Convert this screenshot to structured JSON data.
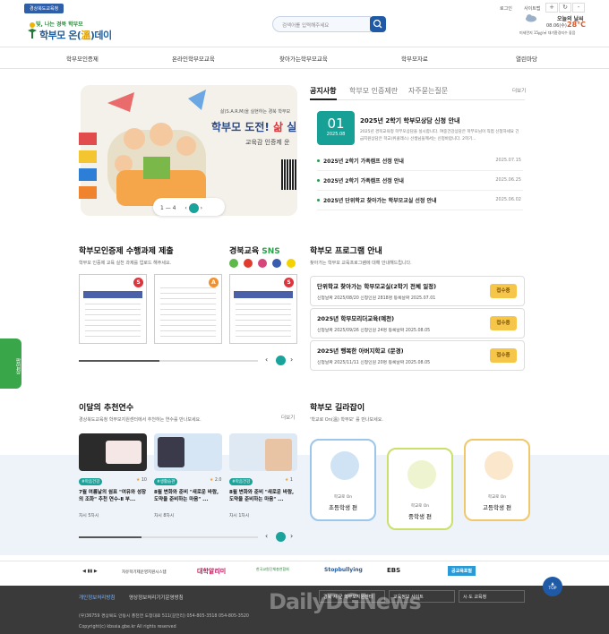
{
  "topbar": {
    "edu_badge": "경상북도교육청",
    "login": "로그인",
    "sitemap": "사이트맵",
    "zoom_in": "+",
    "zoom_out": "-"
  },
  "logo": {
    "line1": "빛, 나는 경북 학부모",
    "line2_a": "학부모 온(",
    "line2_b": "溫",
    "line2_c": ")데이"
  },
  "search": {
    "placeholder": "검색어를 입력해주세요"
  },
  "weather": {
    "title": "오늘의 날씨",
    "date": "08.06(수)",
    "temp": "28°C",
    "dust": "미세먼지 15㎍/㎥ 대기환경지수 좋음"
  },
  "nav": [
    "학부모인증제",
    "온라인학부모교육",
    "찾아가는학부모교육",
    "학부모자료",
    "열린마당"
  ],
  "hero": {
    "subtitle": "삶(S.A.R.M)을 실현하는 경북 학부모",
    "title_a": "학부모 도전!",
    "title_b": "삶",
    "title_c": "실",
    "sub2": "교육감 인증제 운",
    "pager": "1 — 4"
  },
  "notice": {
    "tabs": [
      "공지사항",
      "학부모 인증제란",
      "자주묻는질문"
    ],
    "more": "더보기",
    "featured": {
      "day": "01",
      "month": "2025.08",
      "title": "2025년 2학기 학부모상담 신청 안내",
      "desc": "2025년 경북교육청 학부모상담을 실시합니다. 여중건강상담은 학부모님이 직접 신청하세요 긴급지원상담은 학교(위클래스) 선생님들께서는 신청바랍니다. 2학기..."
    },
    "rows": [
      {
        "title": "2025년 2학기 가족캠프 선정 안내",
        "date": "2025.07.15"
      },
      {
        "title": "2025년 2학기 가족캠프 선정 안내",
        "date": "2025.06.25"
      },
      {
        "title": "2025년 단위학교 찾아가는 학부모교실 선정 안내",
        "date": "2025.06.02"
      }
    ]
  },
  "tasks": {
    "title": "학부모인증제 수행과제 제출",
    "desc": "학부모 인증제 교육 실천 과제를 업로드 해주세요.",
    "badges": [
      "S",
      "A",
      "S"
    ]
  },
  "sns": {
    "title_a": "경북교육",
    "title_b": "SNS"
  },
  "program": {
    "title": "학부모 프로그램 안내",
    "desc": "찾아가는 학부모 교육프로그램에 대해 안내해드립니다.",
    "items": [
      {
        "title": "단위학교 찾아가는 학부모교실(2학기 전체 일정)",
        "meta": "신청날짜 2025/08/20     신청인원 2818명     등록날짜 2025.07.01",
        "btn": "접수중"
      },
      {
        "title": "2025년 학부모리더교육(예천)",
        "meta": "신청날짜 2025/09/26     신청인원 24명     등록날짜 2025.08.05",
        "btn": "접수중"
      },
      {
        "title": "2025년 행복한 아버지학교 (문경)",
        "meta": "신청날짜 2025/11/11     신청인원 20명     등록날짜 2025.08.05",
        "btn": "접수중"
      }
    ]
  },
  "courses": {
    "title": "이달의 추천연수",
    "desc": "경상북도교육청 학부모지원센터에서 추천하는 연수를 만나보세요.",
    "more": "더보기",
    "items": [
      {
        "tag": "#마음건강",
        "score": "10",
        "title": "7월 여름날의 쉼표 \"여유와 성장의 조화\" 추천 연수-Ⅱ 부...",
        "meta": "차시   5차시"
      },
      {
        "tag": "#생활습관",
        "score": "2.0",
        "title": "8월 변화와 준비 \"새로운 바람, 도약을 준비하는 마음\" ...",
        "meta": "차시   8차시"
      },
      {
        "tag": "#마음건강",
        "score": "1",
        "title": "8월 변화와 준비 \"새로운 바람, 도약을 준비하는 마음\" ...",
        "meta": "차시   1차시"
      }
    ]
  },
  "guide": {
    "title": "학부모 길라잡이",
    "desc": "'학교로 On(溫) 학부모' 를 만나보세요.",
    "items": [
      {
        "label": "학교로 On",
        "name": "초등학생 편"
      },
      {
        "label": "학교로 On",
        "name": "중학생 편"
      },
      {
        "label": "학교로 On",
        "name": "고등학생 편"
      }
    ]
  },
  "partners": {
    "controls": "◀ ▮▮ ▶",
    "names": [
      "자유학기제운영지원시스템",
      "대학알리미",
      "한국교원단체총연합회",
      "Stopbullying",
      "EBS",
      "공교육포털"
    ]
  },
  "footer": {
    "links": [
      "개인정보처리방침",
      "영상정보처리기기운영방침"
    ],
    "selects": [
      "경북 시·군 학부모지원센터",
      "교육정보 사이트",
      "시·도 교육청"
    ],
    "address": "(우)36759 경상북도 안동시 풍천면 도청대로 511(갈전리)      054-805-3518      054-805-3520",
    "copyright": "Copyright(c) kbssia.gbe.kr All rights reserved",
    "watermark": "DailyDGNews",
    "top_btn": "TOP"
  },
  "side_tab": "팝업창"
}
